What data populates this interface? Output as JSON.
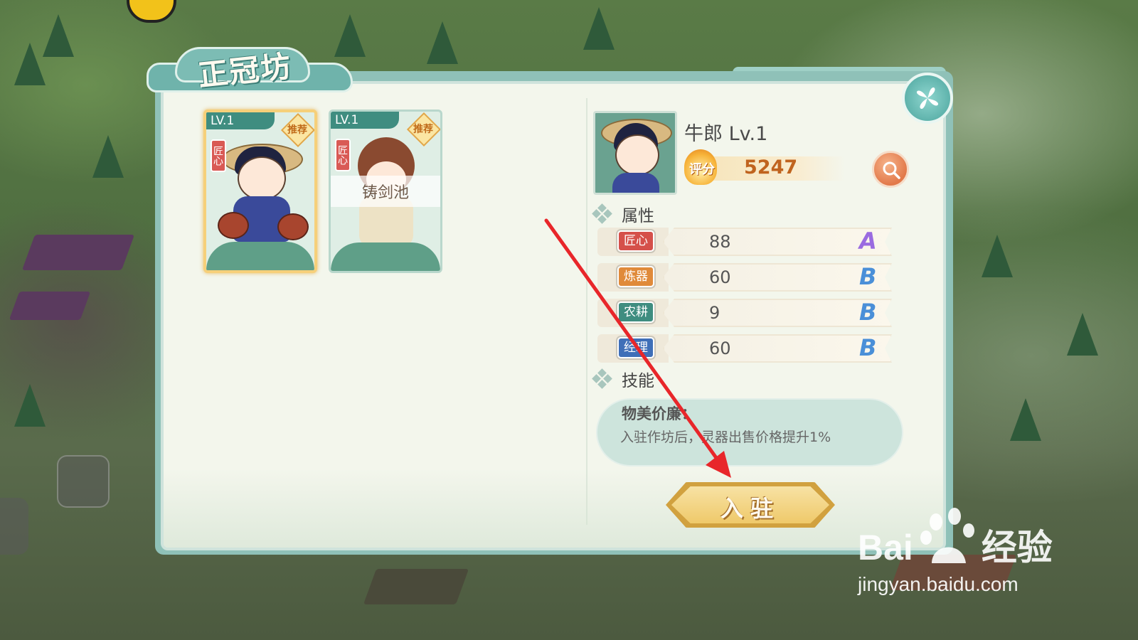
{
  "title": "正冠坊",
  "cards": [
    {
      "level": "LV.1",
      "tag": "匠心",
      "badge": "推荐",
      "overlay": ""
    },
    {
      "level": "LV.1",
      "tag": "匠心",
      "badge": "推荐",
      "overlay": "铸剑池"
    }
  ],
  "hero": {
    "name": "牛郎 Lv.1",
    "score_label": "评分",
    "score": "5247"
  },
  "attributes_title": "属性",
  "attributes": [
    {
      "name": "匠心",
      "value": "88",
      "grade": "A",
      "tag_color": "#d5504a",
      "grade_color": "#9a6be0"
    },
    {
      "name": "炼器",
      "value": "60",
      "grade": "B",
      "tag_color": "#e08a3a",
      "grade_color": "#4a8fd8"
    },
    {
      "name": "农耕",
      "value": "9",
      "grade": "B",
      "tag_color": "#3f8d80",
      "grade_color": "#4a8fd8"
    },
    {
      "name": "经理",
      "value": "60",
      "grade": "B",
      "tag_color": "#3f6fb8",
      "grade_color": "#4a8fd8"
    }
  ],
  "skills_title": "技能",
  "skill": {
    "name": "物美价廉：",
    "desc": "入驻作坊后，灵器出售价格提升1%"
  },
  "join_label": "入驻",
  "watermark": {
    "logo": "Bai",
    "logo2": "经验",
    "url": "jingyan.baidu.com"
  }
}
